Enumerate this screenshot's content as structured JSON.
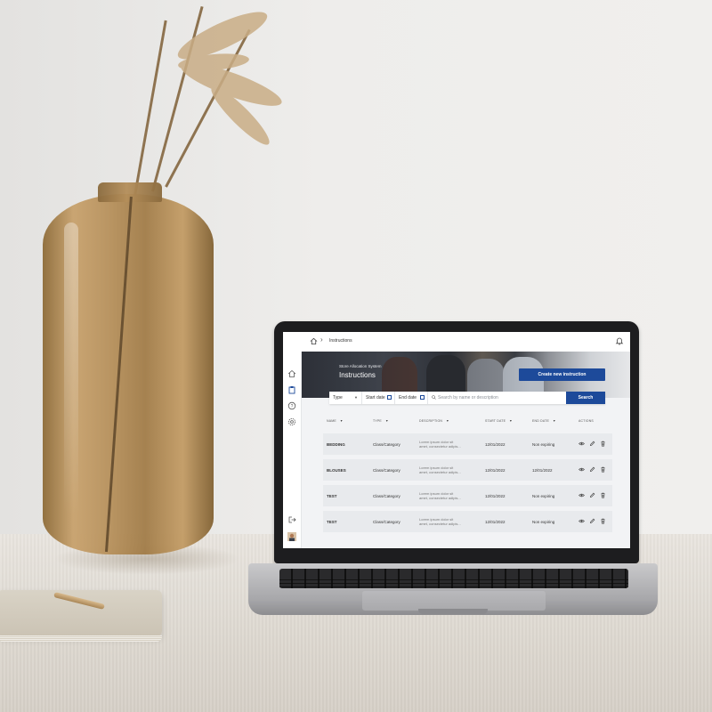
{
  "breadcrumb": {
    "current": "Instructions"
  },
  "hero": {
    "subtitle": "Store Allocation System",
    "title": "Instructions",
    "create_button": "Create new instruction"
  },
  "filters": {
    "type_label": "Type",
    "start_date_label": "Start date",
    "end_date_label": "End date",
    "search_placeholder": "Search by name or description",
    "search_value": "",
    "search_button": "Search"
  },
  "table": {
    "columns": [
      "NAME",
      "TYPE",
      "DESCRIPTION",
      "START DATE",
      "END DATE",
      "ACTIONS"
    ],
    "rows": [
      {
        "name": "BEDDING",
        "type": "Class/Category",
        "desc1": "Lorem ipsum dolor sit",
        "desc2": "amet, consectetur adipis...",
        "start": "12/01/2022",
        "end": "Non expiring"
      },
      {
        "name": "BLOUSES",
        "type": "Class/Category",
        "desc1": "Lorem ipsum dolor sit",
        "desc2": "amet, consectetur adipis...",
        "start": "12/01/2022",
        "end": "12/01/2022"
      },
      {
        "name": "TEST",
        "type": "Class/Category",
        "desc1": "Lorem ipsum dolor sit",
        "desc2": "amet, consectetur adipis...",
        "start": "12/01/2022",
        "end": "Non expiring"
      },
      {
        "name": "TEST",
        "type": "Class/Category",
        "desc1": "Lorem ipsum dolor sit",
        "desc2": "amet, consectetur adipis...",
        "start": "12/01/2022",
        "end": "Non expiring"
      }
    ]
  },
  "icons": {
    "breadcrumb": [
      "home-icon",
      "chevron-right-icon"
    ],
    "topbar": [
      "bell-icon"
    ],
    "sidebar": [
      "home-icon",
      "clipboard-icon",
      "help-icon",
      "settings-icon",
      "logout-icon",
      "avatar"
    ],
    "row_actions": [
      "eye-icon",
      "pencil-icon",
      "trash-icon"
    ]
  },
  "colors": {
    "primary": "#1d4a9a",
    "row_background": "#e8eaed",
    "page_background": "#f2f3f5"
  }
}
